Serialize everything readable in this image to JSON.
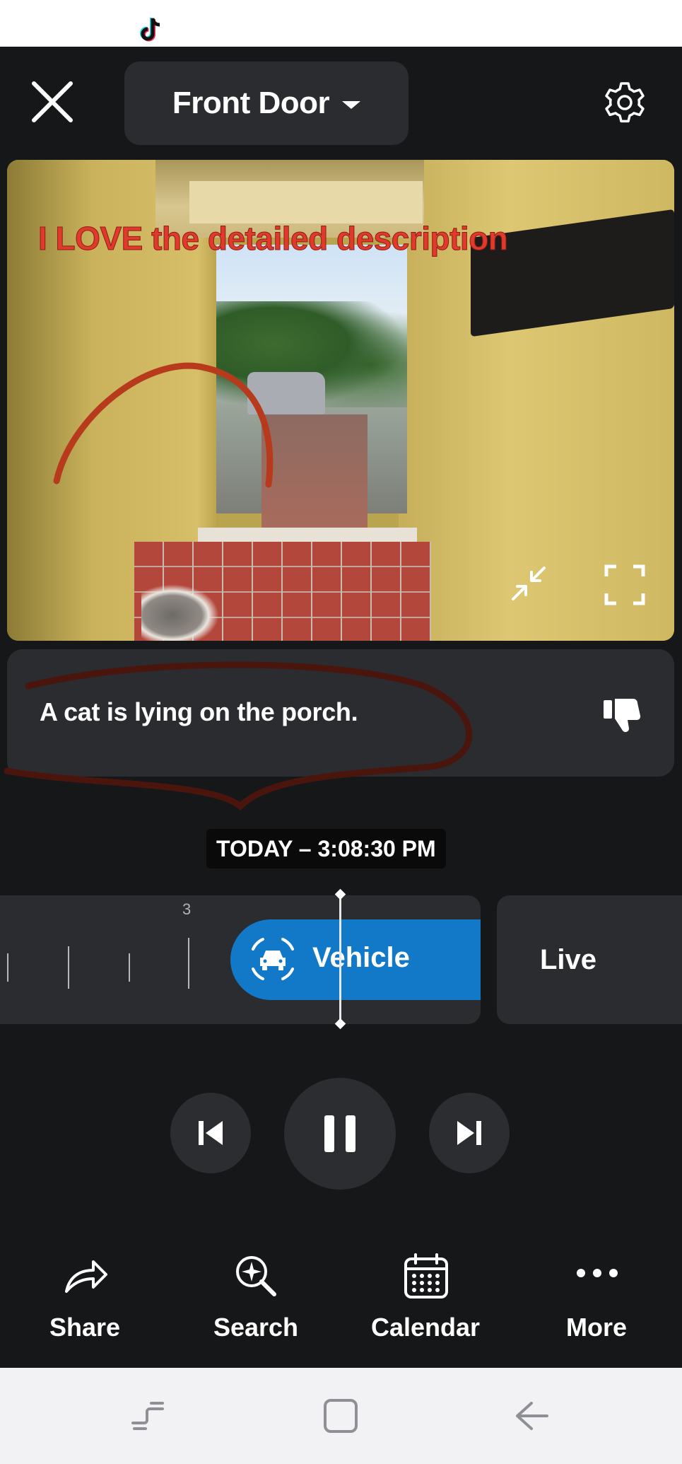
{
  "status_bar": {
    "app_icon": "tiktok-icon"
  },
  "header": {
    "device_name": "Front Door",
    "close_icon": "close-icon",
    "settings_icon": "gear-icon"
  },
  "video": {
    "overlay_text": "I LOVE the detailed description",
    "collapse_icon": "collapse-icon",
    "fullscreen_icon": "fullscreen-icon"
  },
  "description": {
    "text": "A cat is lying on the porch.",
    "feedback_icon": "thumbs-down-icon"
  },
  "timestamp": "TODAY – 3:08:30 PM",
  "timeline": {
    "tick_label": "3",
    "event_label": "Vehicle",
    "event_icon": "vehicle-detection-icon",
    "live_label": "Live",
    "accent_color": "#1278c8"
  },
  "playback": {
    "previous_icon": "skip-previous-icon",
    "pause_icon": "pause-icon",
    "next_icon": "skip-next-icon"
  },
  "bottom_nav": [
    {
      "label": "Share",
      "icon": "share-icon"
    },
    {
      "label": "Search",
      "icon": "search-sparkle-icon"
    },
    {
      "label": "Calendar",
      "icon": "calendar-icon"
    },
    {
      "label": "More",
      "icon": "more-icon"
    }
  ],
  "system_nav": [
    "recents-icon",
    "home-icon",
    "back-icon"
  ]
}
